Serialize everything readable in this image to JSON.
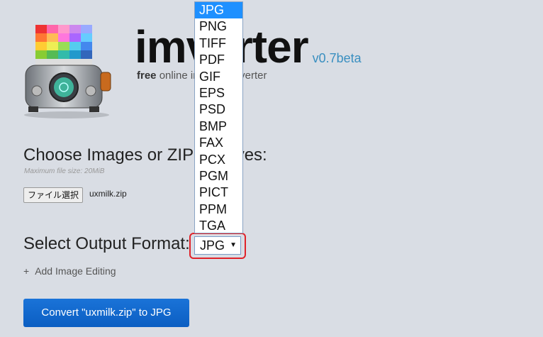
{
  "app": {
    "title": "imverter",
    "version": "v0.7beta",
    "subtitle_bold": "free",
    "subtitle_rest": "online image converter"
  },
  "upload": {
    "heading": "Choose Images or ZIP Archives:",
    "max_size": "Maximum file size: 20MiB",
    "file_button": "ファイル選択",
    "file_name": "uxmilk.zip"
  },
  "output": {
    "label": "Select Output Format:",
    "selected": "JPG",
    "options": [
      "JPG",
      "PNG",
      "TIFF",
      "PDF",
      "GIF",
      "EPS",
      "PSD",
      "BMP",
      "FAX",
      "PCX",
      "PGM",
      "PICT",
      "PPM",
      "TGA"
    ]
  },
  "editing": {
    "plus": "+",
    "label": "Add Image Editing"
  },
  "convert": {
    "label": "Convert  \"uxmilk.zip\"  to JPG"
  },
  "colors": {
    "accent": "#1a73d8",
    "highlight": "#e0232a",
    "version": "#3a8fc0"
  }
}
